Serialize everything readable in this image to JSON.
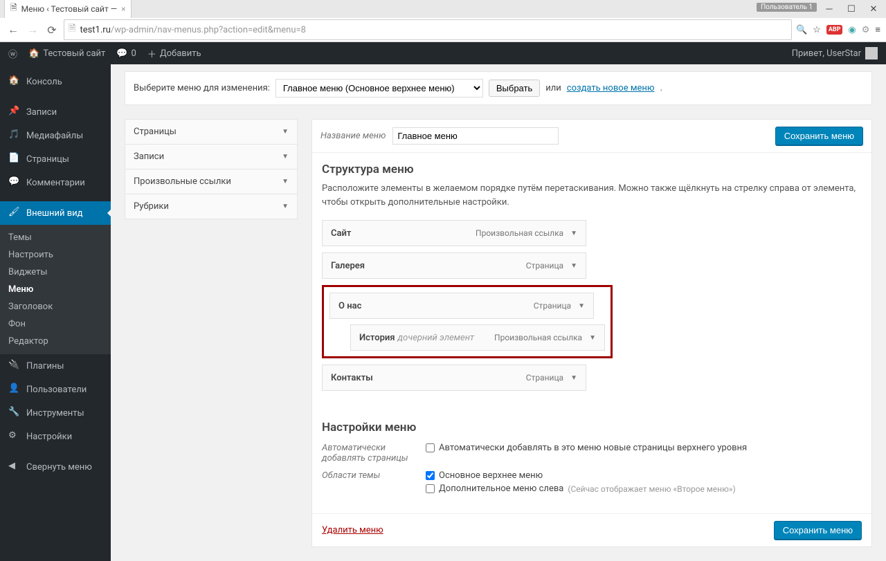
{
  "browser": {
    "tab_title": "Меню ‹ Тестовый сайт —",
    "url_host": "test1.ru",
    "url_path": "/wp-admin/nav-menus.php?action=edit&menu=8",
    "user_badge": "Пользователь 1"
  },
  "adminbar": {
    "site_name": "Тестовый сайт",
    "comment_count": "0",
    "add_new": "Добавить",
    "greeting": "Привет, UserStar"
  },
  "sidebar": {
    "items": [
      {
        "label": "Консоль"
      },
      {
        "label": "Записи"
      },
      {
        "label": "Медиафайлы"
      },
      {
        "label": "Страницы"
      },
      {
        "label": "Комментарии"
      },
      {
        "label": "Внешний вид",
        "active": true
      },
      {
        "label": "Плагины"
      },
      {
        "label": "Пользователи"
      },
      {
        "label": "Инструменты"
      },
      {
        "label": "Настройки"
      },
      {
        "label": "Свернуть меню"
      }
    ],
    "appearance_sub": [
      {
        "label": "Темы"
      },
      {
        "label": "Настроить"
      },
      {
        "label": "Виджеты"
      },
      {
        "label": "Меню",
        "current": true
      },
      {
        "label": "Заголовок"
      },
      {
        "label": "Фон"
      },
      {
        "label": "Редактор"
      }
    ]
  },
  "selector": {
    "label": "Выберите меню для изменения:",
    "selected": "Главное меню (Основное верхнее меню)",
    "choose_btn": "Выбрать",
    "or": "или",
    "create_link": "создать новое меню"
  },
  "accordion": {
    "items": [
      {
        "label": "Страницы"
      },
      {
        "label": "Записи"
      },
      {
        "label": "Произвольные ссылки"
      },
      {
        "label": "Рубрики"
      }
    ]
  },
  "menu": {
    "name_label": "Название меню",
    "name_value": "Главное меню",
    "save_btn": "Сохранить меню",
    "structure_title": "Структура меню",
    "structure_hint": "Расположите элементы в желаемом порядке путём перетаскивания. Можно также щёлкнуть на стрелку справа от элемента, чтобы открыть дополнительные настройки.",
    "items": [
      {
        "title": "Сайт",
        "type": "Произвольная ссылка"
      },
      {
        "title": "Галерея",
        "type": "Страница"
      },
      {
        "title": "О нас",
        "type": "Страница",
        "highlight": true
      },
      {
        "title": "История",
        "type": "Произвольная ссылка",
        "sub": "дочерний элемент",
        "highlight": true,
        "indent": true
      },
      {
        "title": "Контакты",
        "type": "Страница"
      }
    ],
    "settings_title": "Настройки меню",
    "auto_label": "Автоматически добавлять страницы",
    "auto_check": "Автоматически добавлять в это меню новые страницы верхнего уровня",
    "theme_loc_label": "Области темы",
    "theme_loc_main": "Основное верхнее меню",
    "theme_loc_side": "Дополнительное меню слева",
    "theme_loc_note": "(Сейчас отображает меню «Второе меню»)",
    "delete_link": "Удалить меню"
  }
}
